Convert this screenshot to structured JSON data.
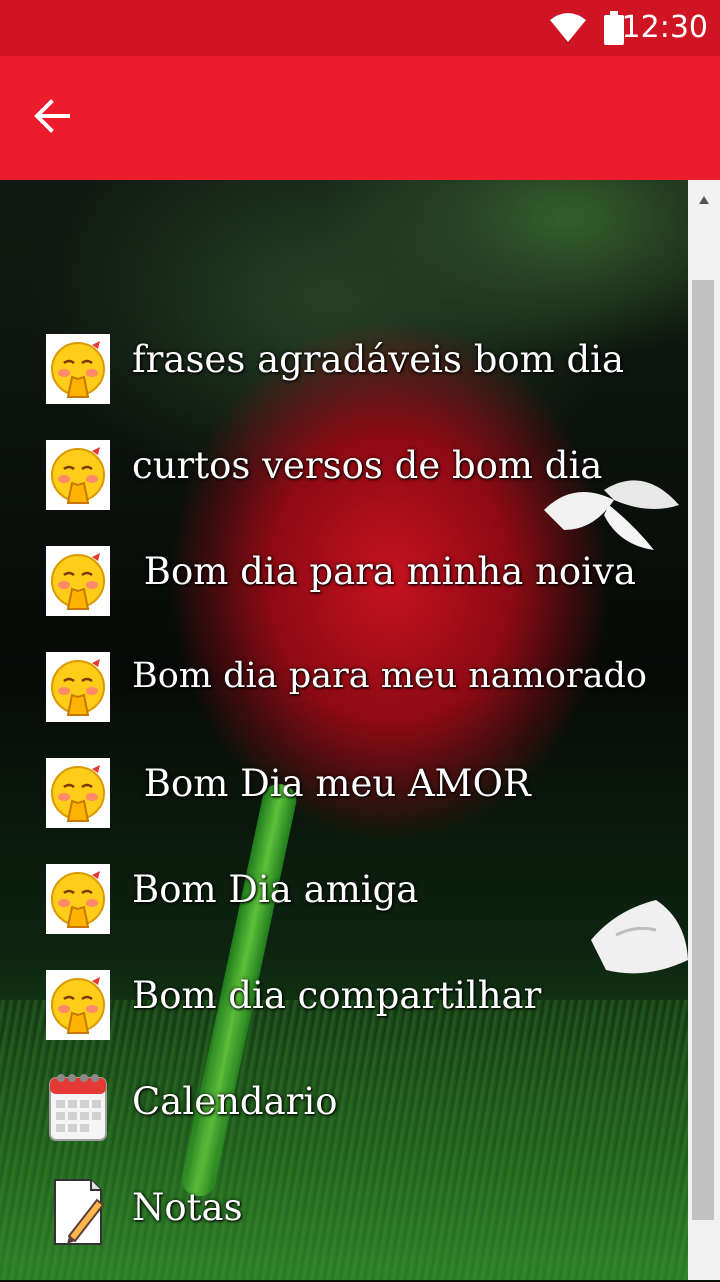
{
  "status_bar": {
    "time": "12:30"
  },
  "app_bar": {
    "back_icon": "arrow-back-icon",
    "color": "#ed1c2c"
  },
  "menu": {
    "items": [
      {
        "label": "frases agradáveis bom dia",
        "icon": "blushing-emoji-icon"
      },
      {
        "label": "curtos versos de bom dia",
        "icon": "blushing-emoji-icon"
      },
      {
        "label": " Bom dia para minha noiva",
        "icon": "blushing-emoji-icon"
      },
      {
        "label": "Bom dia para meu namorado",
        "icon": "blushing-emoji-icon"
      },
      {
        "label": " Bom Dia meu AMOR",
        "icon": "blushing-emoji-icon"
      },
      {
        "label": "Bom Dia amiga",
        "icon": "blushing-emoji-icon"
      },
      {
        "label": "Bom dia compartilhar",
        "icon": "blushing-emoji-icon"
      },
      {
        "label": "Calendario",
        "icon": "calendar-icon"
      },
      {
        "label": "Notas",
        "icon": "notepad-pencil-icon"
      }
    ]
  }
}
